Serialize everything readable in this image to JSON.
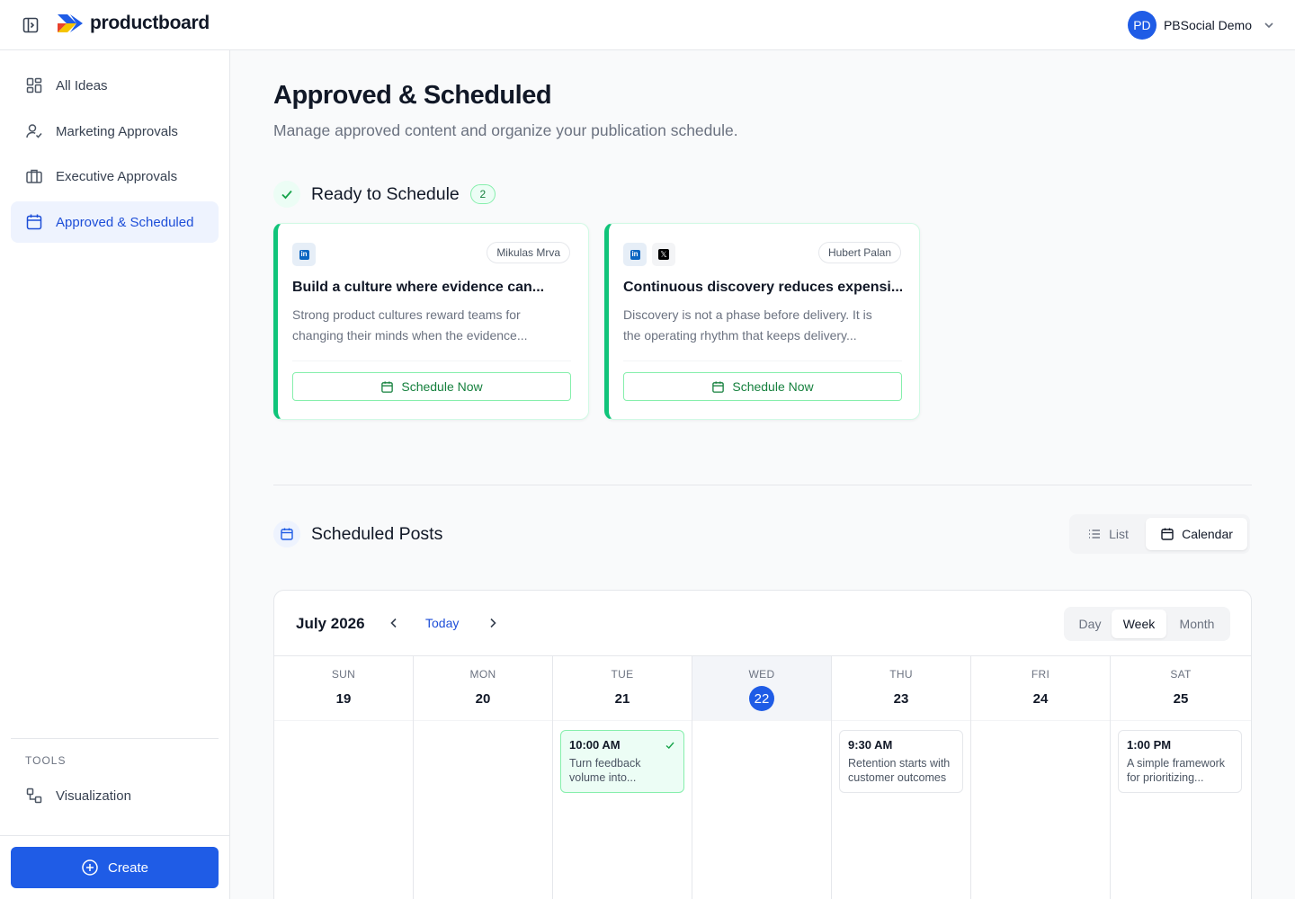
{
  "app": {
    "brand": "productboard",
    "user": {
      "initials": "PD",
      "name": "PBSocial Demo"
    }
  },
  "sidebar": {
    "items": [
      {
        "label": "All Ideas",
        "icon": "grid-icon"
      },
      {
        "label": "Marketing Approvals",
        "icon": "user-check-icon"
      },
      {
        "label": "Executive Approvals",
        "icon": "briefcase-icon"
      },
      {
        "label": "Approved & Scheduled",
        "icon": "calendar-icon",
        "active": true
      }
    ],
    "tools_label": "TOOLS",
    "tools": [
      {
        "label": "Visualization",
        "icon": "diagram-icon"
      }
    ],
    "create_label": "Create"
  },
  "page": {
    "title": "Approved & Scheduled",
    "subtitle": "Manage approved content and organize your publication schedule."
  },
  "ready": {
    "title": "Ready to Schedule",
    "count": "2",
    "cards": [
      {
        "platforms": [
          "linkedin"
        ],
        "author": "Mikulas Mrva",
        "title": "Build a culture where evidence can...",
        "body": "Strong product cultures reward teams for changing their minds when the evidence...",
        "button": "Schedule Now"
      },
      {
        "platforms": [
          "linkedin",
          "x"
        ],
        "author": "Hubert Palan",
        "title": "Continuous discovery reduces expensi...",
        "body": "Discovery is not a phase before delivery. It is the operating rhythm that keeps delivery...",
        "button": "Schedule Now"
      }
    ]
  },
  "scheduled": {
    "title": "Scheduled Posts",
    "view_toggle": {
      "list": "List",
      "calendar": "Calendar",
      "active": "calendar"
    }
  },
  "calendar": {
    "month": "July 2026",
    "today_label": "Today",
    "ranges": {
      "day": "Day",
      "week": "Week",
      "month": "Month",
      "active": "week"
    },
    "days": [
      {
        "dow": "SUN",
        "num": "19"
      },
      {
        "dow": "MON",
        "num": "20"
      },
      {
        "dow": "TUE",
        "num": "21"
      },
      {
        "dow": "WED",
        "num": "22",
        "today": true
      },
      {
        "dow": "THU",
        "num": "23"
      },
      {
        "dow": "FRI",
        "num": "24"
      },
      {
        "dow": "SAT",
        "num": "25"
      }
    ],
    "events": {
      "tue": {
        "time": "10:00 AM",
        "text": "Turn feedback volume into...",
        "approved": true
      },
      "thu": {
        "time": "9:30 AM",
        "text": "Retention starts with customer outcomes"
      },
      "sat": {
        "time": "1:00 PM",
        "text": "A simple framework for prioritizing..."
      }
    }
  },
  "colors": {
    "accent": "#1f5ce6",
    "success": "#10c47a"
  }
}
